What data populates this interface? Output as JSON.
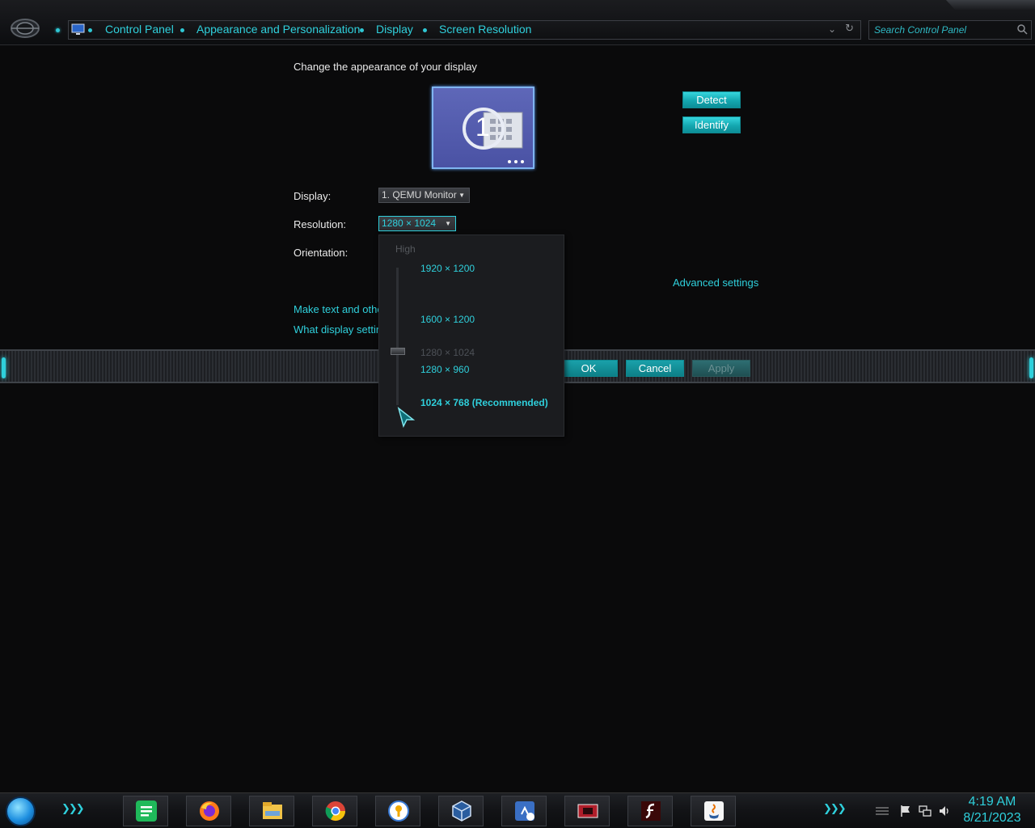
{
  "breadcrumb": [
    "Control Panel",
    "Appearance and Personalization",
    "Display",
    "Screen Resolution"
  ],
  "search": {
    "placeholder": "Search Control Panel"
  },
  "main": {
    "heading": "Change the appearance of your display",
    "monitor_number": "1",
    "detect_label": "Detect",
    "identify_label": "Identify",
    "display_label": "Display:",
    "display_value": "1. QEMU Monitor",
    "resolution_label": "Resolution:",
    "resolution_value": "1280 × 1024",
    "orientation_label": "Orientation:",
    "advanced_link": "Advanced settings",
    "text_size_link": "Make text and other",
    "display_settings_link": "What display setting"
  },
  "resolution_dropdown": {
    "high_label": "High",
    "options": [
      "1920 × 1200",
      "1600 × 1200",
      "1280 × 1024",
      "1280 × 960",
      "1024 × 768 (Recommended)"
    ],
    "current_option": "1280 × 1024",
    "slider_fraction": 0.62
  },
  "actions": {
    "ok_label": "OK",
    "cancel_label": "Cancel",
    "apply_label": "Apply"
  },
  "taskbar": {
    "apps": [
      "spreadsheet-icon",
      "firefox-icon",
      "file-explorer-icon",
      "chrome-icon",
      "keepass-icon",
      "virtualbox-icon",
      "sa7-icon",
      "media-icon",
      "flash-icon",
      "java-icon"
    ],
    "clock_time": "4:19 AM",
    "clock_date": "8/21/2023"
  },
  "colors": {
    "accent": "#2fd0dc",
    "background": "#0a0a0b",
    "monitor": "#4a52a4"
  }
}
